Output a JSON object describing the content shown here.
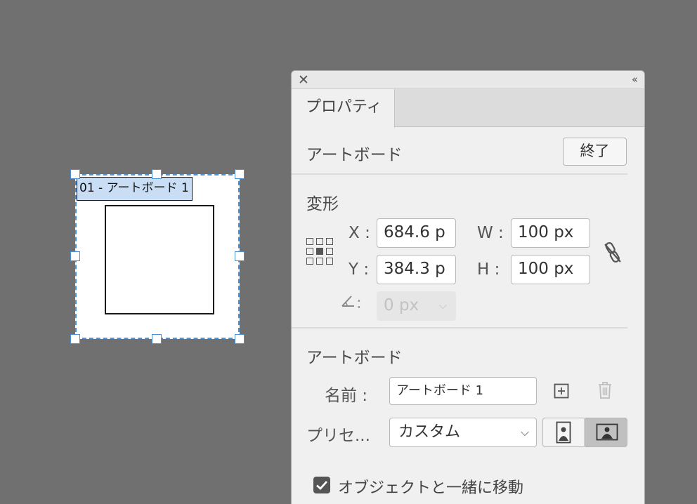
{
  "canvas": {
    "artboard_label": "01 - アートボード 1"
  },
  "panel": {
    "tab_label": "プロパティ",
    "context_title": "アートボード",
    "done_button": "終了",
    "transform": {
      "title": "変形",
      "x_label": "X :",
      "x_value": "684.6 p",
      "y_label": "Y :",
      "y_value": "384.3 p",
      "w_label": "W :",
      "w_value": "100 px",
      "h_label": "H :",
      "h_value": "100 px",
      "angle_label": ":",
      "angle_value": "0 px"
    },
    "artboard": {
      "title": "アートボード",
      "name_label": "名前 :",
      "name_value": "アートボード 1",
      "preset_label": "プリセ...",
      "preset_value": "カスタム",
      "move_with_objects_label": "オブジェクトと一緒に移動",
      "move_with_objects_checked": true
    }
  },
  "icons": {
    "close": "close-icon",
    "collapse": "collapse-icon",
    "reference_point": "reference-point-icon",
    "link": "constrain-proportions-icon",
    "angle": "angle-icon",
    "new_artboard": "new-artboard-icon",
    "delete": "trash-icon",
    "portrait": "portrait-orientation-icon",
    "landscape": "landscape-orientation-icon"
  }
}
